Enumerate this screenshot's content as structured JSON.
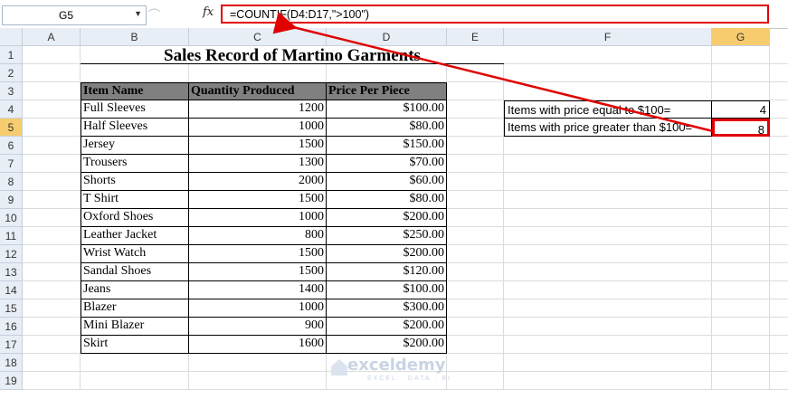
{
  "formula_bar": {
    "name_box": "G5",
    "fx_label": "fx",
    "formula": "=COUNTIF(D4:D17,\">100\")"
  },
  "columns": [
    "A",
    "B",
    "C",
    "D",
    "E",
    "F",
    "G"
  ],
  "rows": [
    "1",
    "2",
    "3",
    "4",
    "5",
    "6",
    "7",
    "8",
    "9",
    "10",
    "11",
    "12",
    "13",
    "14",
    "15",
    "16",
    "17",
    "18",
    "19"
  ],
  "selected": {
    "column": "G",
    "row": "5"
  },
  "sheet": {
    "title": "Sales Record of Martino Garments",
    "headers": [
      "Item Name",
      "Quantity Produced",
      "Price Per Piece"
    ],
    "items": [
      {
        "name": "Full Sleeves",
        "qty": "1200",
        "price": "$100.00"
      },
      {
        "name": "Half Sleeves",
        "qty": "1000",
        "price": "$80.00"
      },
      {
        "name": "Jersey",
        "qty": "1500",
        "price": "$150.00"
      },
      {
        "name": "Trousers",
        "qty": "1300",
        "price": "$70.00"
      },
      {
        "name": "Shorts",
        "qty": "2000",
        "price": "$60.00"
      },
      {
        "name": "T Shirt",
        "qty": "1500",
        "price": "$80.00"
      },
      {
        "name": "Oxford Shoes",
        "qty": "1000",
        "price": "$200.00"
      },
      {
        "name": "Leather Jacket",
        "qty": "800",
        "price": "$250.00"
      },
      {
        "name": "Wrist Watch",
        "qty": "1500",
        "price": "$200.00"
      },
      {
        "name": "Sandal Shoes",
        "qty": "1500",
        "price": "$120.00"
      },
      {
        "name": "Jeans",
        "qty": "1400",
        "price": "$100.00"
      },
      {
        "name": "Blazer",
        "qty": "1000",
        "price": "$300.00"
      },
      {
        "name": "Mini Blazer",
        "qty": "900",
        "price": "$200.00"
      },
      {
        "name": "Skirt",
        "qty": "1600",
        "price": "$200.00"
      }
    ],
    "summary": [
      {
        "label": "Items with price equal to $100=",
        "value": "4"
      },
      {
        "label": "Items with price greater than $100=",
        "value": "8"
      }
    ]
  },
  "watermark": {
    "name": "exceldemy",
    "tagline": "EXCEL · DATA · BI"
  },
  "colors": {
    "highlight": "#e00000",
    "selected_header": "#f7cc6e",
    "table_header_bg": "#808080"
  }
}
